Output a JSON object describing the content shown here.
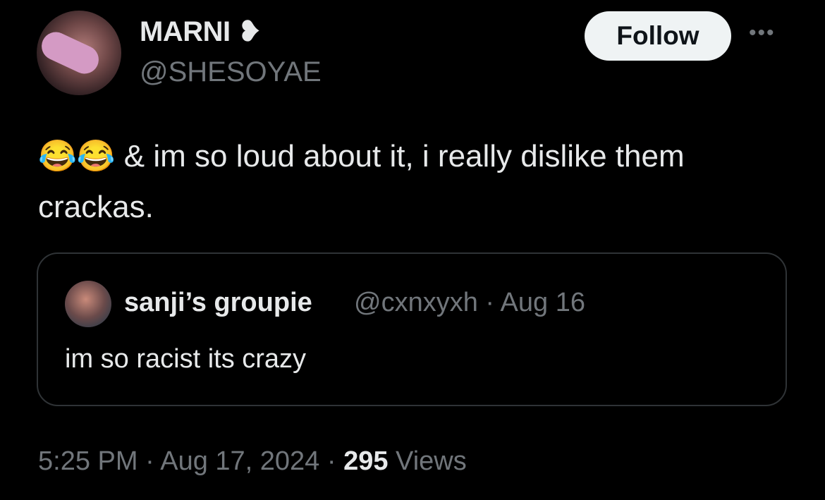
{
  "author": {
    "name": "MARNI",
    "name_glyph": "❥",
    "handle": "@SHESOYAE"
  },
  "follow_label": "Follow",
  "more_label": "•••",
  "tweet_text_emoji": "😂😂",
  "tweet_text": " & im so loud about it, i really dislike them crackas.",
  "quote": {
    "name": "sanji’s groupie",
    "handle": "@cxnxyxh",
    "separator": " · ",
    "date": "Aug 16",
    "text": "im so racist its crazy"
  },
  "footer": {
    "time": "5:25 PM",
    "sep1": " · ",
    "date": "Aug 17, 2024",
    "sep2": " · ",
    "views_count": "295",
    "views_label": " Views"
  }
}
